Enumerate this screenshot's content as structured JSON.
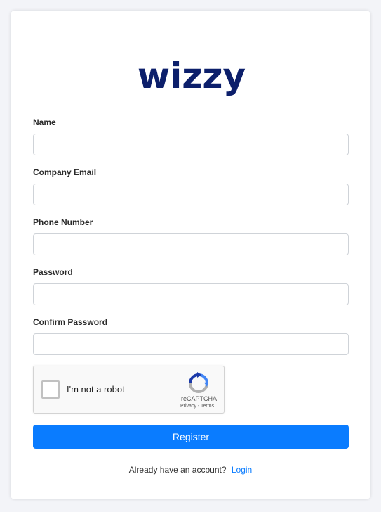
{
  "brand": {
    "logo_text": "wizzy",
    "logo_color": "#0c1f6b"
  },
  "form": {
    "fields": [
      {
        "label": "Name",
        "value": "",
        "placeholder": ""
      },
      {
        "label": "Company Email",
        "value": "",
        "placeholder": ""
      },
      {
        "label": "Phone Number",
        "value": "",
        "placeholder": ""
      },
      {
        "label": "Password",
        "value": "",
        "placeholder": ""
      },
      {
        "label": "Confirm Password",
        "value": "",
        "placeholder": ""
      }
    ],
    "captcha": {
      "label": "I'm not a robot",
      "brand": "reCAPTCHA",
      "links": "Privacy - Terms",
      "checked": false
    },
    "submit_label": "Register",
    "footer": {
      "text": "Already have an account?",
      "link_label": "Login"
    }
  },
  "colors": {
    "accent": "#0a7cff",
    "background": "#f3f4f8"
  }
}
